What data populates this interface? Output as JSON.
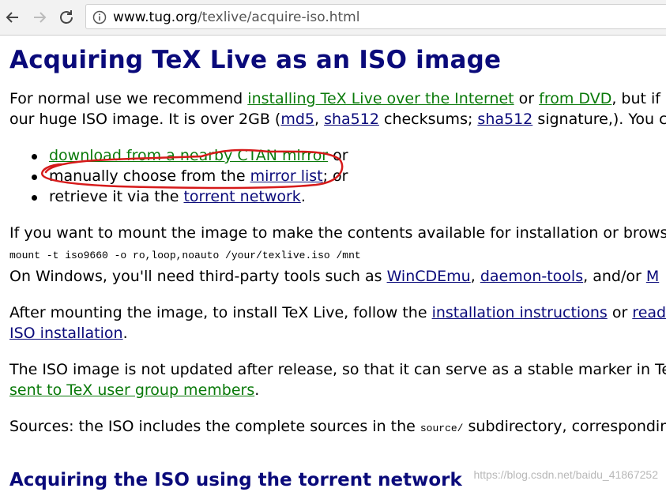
{
  "browser": {
    "back_icon": "arrow-left-icon",
    "forward_icon": "arrow-right-icon",
    "reload_icon": "reload-icon",
    "info_icon": "info-icon",
    "url_host": "www.tug.org",
    "url_path": "/texlive/acquire-iso.html"
  },
  "page": {
    "title": "Acquiring TeX Live as an ISO image",
    "intro": {
      "t1": "For normal use we recommend ",
      "l1": "installing TeX Live over the Internet",
      "t2": " or ",
      "l2": "from DVD",
      "t3": ", but if",
      "t4": "our huge ISO image. It is over 2GB (",
      "l3": "md5",
      "t5": ", ",
      "l4": "sha512",
      "t6": " checksums; ",
      "l5": "sha512",
      "t7": " signature,). You ca"
    },
    "options": [
      {
        "link": "download from a nearby CTAN mirror",
        "after": " or"
      },
      {
        "before": "manually choose from the ",
        "link": "mirror list",
        "after": "; or"
      },
      {
        "before": "retrieve it via the ",
        "link": "torrent network",
        "after": "."
      }
    ],
    "mount": {
      "text": "If you want to mount the image to make the contents available for installation or brows",
      "command": "mount  -t  iso9660  -o  ro,loop,noauto  /your/texlive.iso  /mnt"
    },
    "windows": {
      "t1": "On Windows, you'll need third-party tools such as ",
      "l1": "WinCDEmu",
      "t2": ", ",
      "l2": "daemon-tools",
      "t3": ", and/or ",
      "l3": "M"
    },
    "after_mount": {
      "t1": "After mounting the image, to install TeX Live, follow the ",
      "l1": "installation instructions",
      "t2": " or ",
      "l2": "read",
      "l3": "ISO installation",
      "t3": "."
    },
    "not_updated": {
      "t1": "The ISO image is not updated after release, so that it can serve as a stable marker in Te",
      "l1": "sent to TeX user group members",
      "t2": "."
    },
    "sources": {
      "t1": "Sources: the ISO includes the complete sources in the ",
      "code": "source/",
      "t2": " subdirectory, correspondin"
    },
    "torrent_heading": "Acquiring the ISO using the torrent network"
  },
  "watermark": "https://blog.csdn.net/baidu_41867252",
  "colors": {
    "heading": "#0a0a7a",
    "external_link": "#0a7a0a",
    "internal_link": "#0a0a7a",
    "annotation": "#d61a1a"
  }
}
